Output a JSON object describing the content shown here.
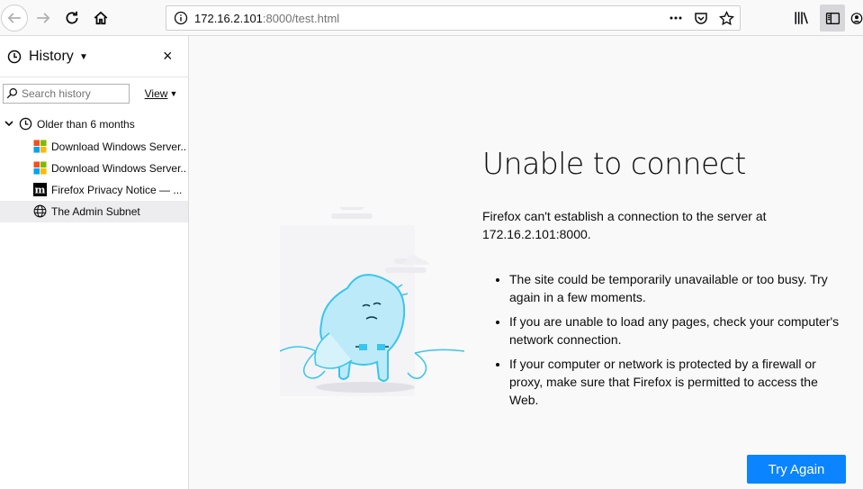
{
  "toolbar": {
    "url_host": "172.16.2.101",
    "url_rest": ":8000/test.html"
  },
  "sidebar": {
    "title": "History",
    "close_glyph": "×",
    "search_placeholder": "Search history",
    "view_label": "View",
    "group_label": "Older than 6 months",
    "items": [
      {
        "label": "Download Windows Server...",
        "icon": "windows-icon"
      },
      {
        "label": "Download Windows Server...",
        "icon": "windows-icon"
      },
      {
        "label": "Firefox Privacy Notice — ...",
        "icon": "mozilla-icon"
      },
      {
        "label": "The Admin Subnet",
        "icon": "globe-icon"
      }
    ]
  },
  "error": {
    "title": "Unable to connect",
    "description": "Firefox can't establish a connection to the server at 172.16.2.101:8000.",
    "reasons": [
      "The site could be temporarily unavailable or too busy. Try again in a few moments.",
      "If you are unable to load any pages, check your computer's network connection.",
      "If your computer or network is protected by a firewall or proxy, make sure that Firefox is permitted to access the Web."
    ],
    "button": "Try Again"
  },
  "colors": {
    "accent": "#0a84ff",
    "illustration": "#38c5ee"
  }
}
